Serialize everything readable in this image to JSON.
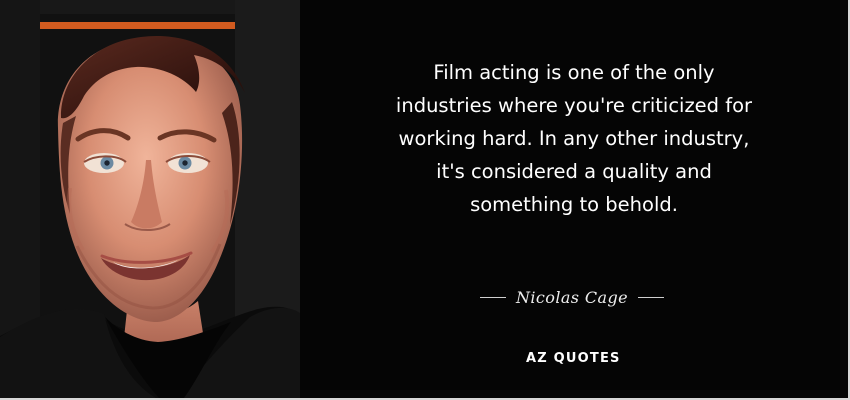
{
  "quote": {
    "text": "Film acting is one of the only\nindustries where you're criticized for\nworking hard. In any other industry,\nit's considered a quality and\nsomething to behold."
  },
  "author": {
    "name": "Nicolas Cage"
  },
  "brand": {
    "logo": "AZ QUOTES"
  },
  "colors": {
    "background": "#050505",
    "text": "#ffffff",
    "border": "#d8d8d8"
  },
  "icons": {
    "logo": "azquotes-logo"
  }
}
